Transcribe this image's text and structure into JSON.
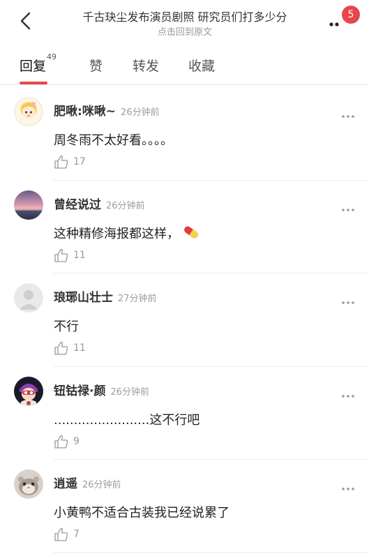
{
  "header": {
    "title": "千古玦尘发布演员剧照 研究员们打多少分",
    "subtitle": "点击回到原文",
    "badge_count": "5",
    "back_icon": "back-chevron-icon",
    "more_icon": "more-dots-icon"
  },
  "tabs": [
    {
      "label": "回复",
      "count": "49",
      "active": true
    },
    {
      "label": "赞",
      "count": "",
      "active": false
    },
    {
      "label": "转发",
      "count": "",
      "active": false
    },
    {
      "label": "收藏",
      "count": "",
      "active": false
    }
  ],
  "colors": {
    "accent": "#e8474a",
    "muted": "#9d9d9d"
  },
  "comments": [
    {
      "user": "肥啾:咪啾~",
      "time": "26分钟前",
      "text": "周冬雨不太好看。。。。",
      "likes": "17",
      "avatar": "cartoon-girl-avatar"
    },
    {
      "user": "曾经说过",
      "time": "26分钟前",
      "text": "这种精修海报都这样，",
      "likes": "11",
      "avatar": "sunset-sea-avatar",
      "emoji": "pill-icon"
    },
    {
      "user": "琅琊山壮士",
      "time": "27分钟前",
      "text": "不行",
      "likes": "11",
      "avatar": "default-user-avatar"
    },
    {
      "user": "钮钴禄·颜",
      "time": "26分钟前",
      "text": "........................这不行吧",
      "likes": "9",
      "avatar": "anime-character-avatar"
    },
    {
      "user": "逍遥",
      "time": "26分钟前",
      "text": "小黄鸭不适合古装我已经说累了",
      "likes": "7",
      "avatar": "hamster-avatar"
    }
  ]
}
